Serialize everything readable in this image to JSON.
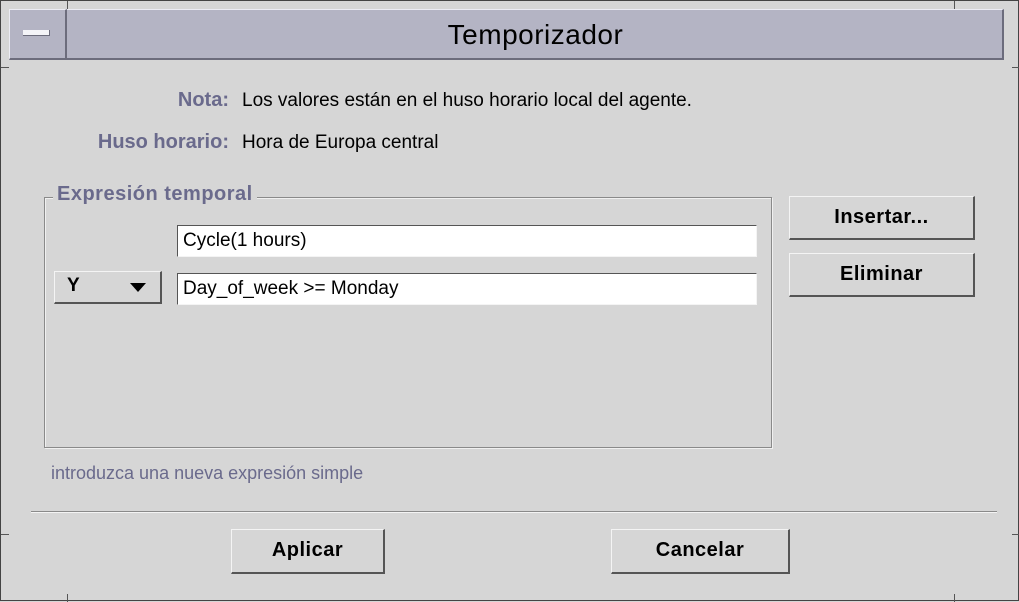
{
  "window": {
    "title": "Temporizador"
  },
  "info": {
    "note_label": "Nota:",
    "note_value": "Los valores están en el huso horario local del agente.",
    "timezone_label": "Huso horario:",
    "timezone_value": "Hora de Europa central"
  },
  "expression_group": {
    "title": "Expresión temporal",
    "rows": [
      {
        "operator": "",
        "expression": "Cycle(1 hours)"
      },
      {
        "operator": "Y",
        "expression": "Day_of_week >= Monday"
      }
    ],
    "operator_icon": "chevron-down-icon"
  },
  "side_buttons": {
    "insert_label": "Insertar...",
    "delete_label": "Eliminar"
  },
  "status": {
    "hint": "introduzca una nueva expresión simple"
  },
  "footer": {
    "apply_label": "Aplicar",
    "cancel_label": "Cancelar"
  },
  "colors": {
    "background": "#d6d6d6",
    "titlebar": "#b4b4c4",
    "label": "#6a6a8c"
  }
}
